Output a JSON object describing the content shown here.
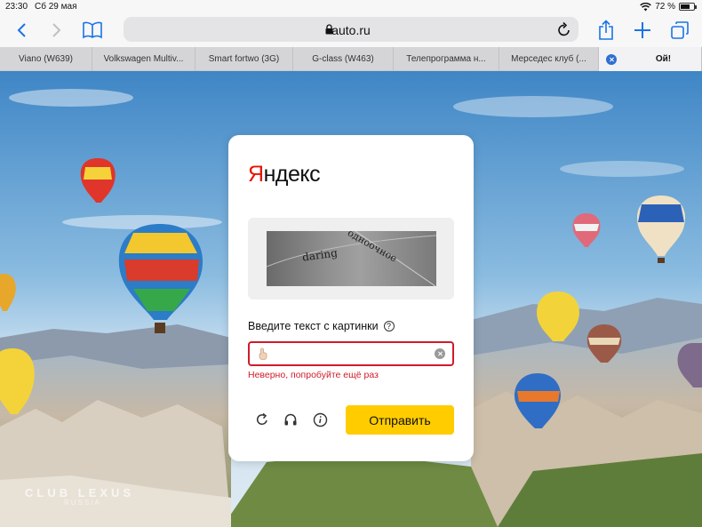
{
  "status_bar": {
    "time": "23:30",
    "date": "Сб 29 мая",
    "battery": "72 %",
    "battery_level": 0.72
  },
  "browser": {
    "url_host": "auto.ru",
    "icons": {
      "back": "chevron-left-icon",
      "forward": "chevron-right-icon",
      "bookmarks": "book-icon",
      "lock": "lock-icon",
      "reload": "reload-icon",
      "share": "share-icon",
      "new_tab": "plus-icon",
      "tabs": "tabs-icon"
    }
  },
  "tabs": [
    {
      "label": "Viano (W639)"
    },
    {
      "label": "Volkswagen Multiv..."
    },
    {
      "label": "Smart fortwo (3G)"
    },
    {
      "label": "G-class (W463)"
    },
    {
      "label": "Телепрограмма н..."
    },
    {
      "label": "Мерседес клуб (..."
    },
    {
      "label": "Ой!",
      "active": true
    }
  ],
  "watermark": {
    "line1": "CLUB LEXUS",
    "line2": "RUSSIA"
  },
  "captcha_card": {
    "logo_first": "Я",
    "logo_rest": "ндекс",
    "captcha_words": [
      "daring",
      "одноочное"
    ],
    "prompt": "Введите текст с картинки",
    "help_icon": "question-circle-icon",
    "input_value": "",
    "error": "Неверно, попробуйте ещё раз",
    "actions": {
      "refresh": "refresh-icon",
      "audio": "headphones-icon",
      "info": "info-icon"
    },
    "submit_label": "Отправить",
    "colors": {
      "accent": "#ffcc00",
      "error": "#d01b2a",
      "logo": "#e61400"
    }
  }
}
